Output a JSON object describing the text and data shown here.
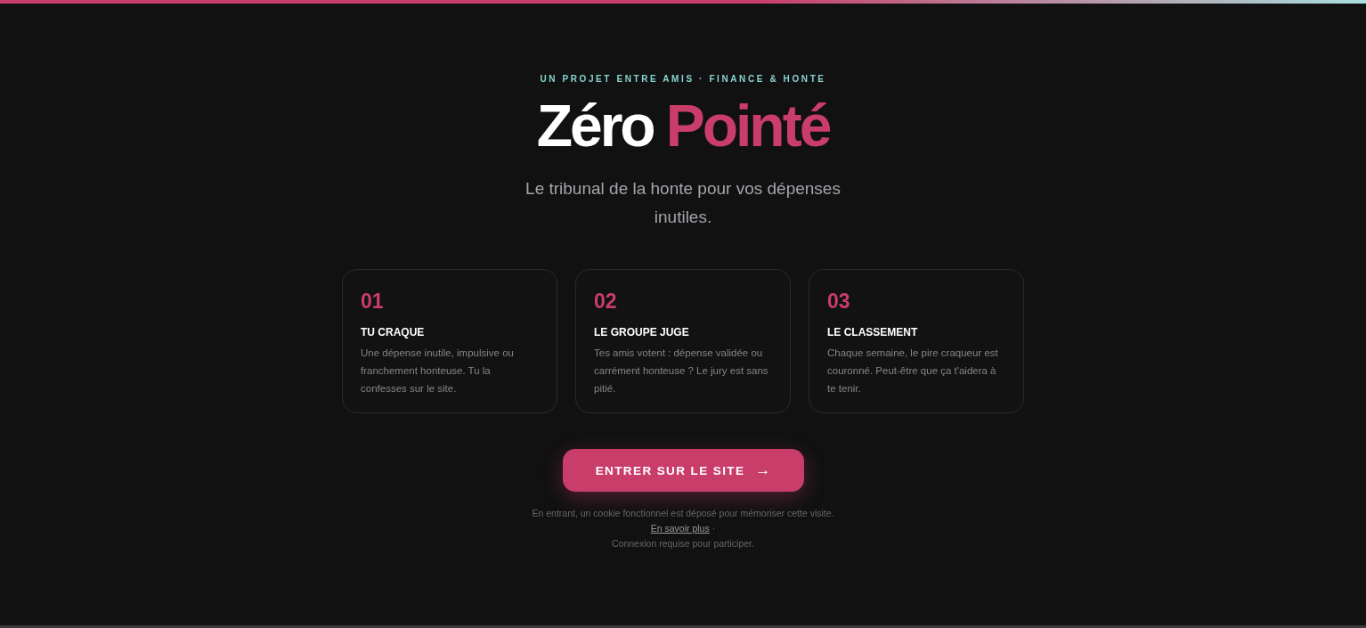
{
  "eyebrow": "UN PROJET ENTRE AMIS · FINANCE & HONTE",
  "title": {
    "first": "Zéro",
    "accent": "Pointé"
  },
  "subtitle": "Le tribunal de la honte pour vos dépenses inutiles.",
  "steps": [
    {
      "number": "01",
      "title": "TU CRAQUE",
      "text": "Une dépense inutile, impulsive ou franchement honteuse. Tu la confesses sur le site."
    },
    {
      "number": "02",
      "title": "LE GROUPE JUGE",
      "text": "Tes amis votent : dépense validée ou carrément honteuse ? Le jury est sans pitié."
    },
    {
      "number": "03",
      "title": "LE CLASSEMENT",
      "text": "Chaque semaine, le pire craqueur est couronné. Peut-être que ça t'aidera à te tenir."
    }
  ],
  "enter_button": {
    "label": "ENTRER SUR LE SITE",
    "arrow": "→"
  },
  "notice": {
    "text": "En entrant, un cookie fonctionnel est déposé pour mémoriser cette visite.",
    "link": "En savoir plus",
    "separator": "·",
    "login_note": "Connexion requise pour participer."
  }
}
